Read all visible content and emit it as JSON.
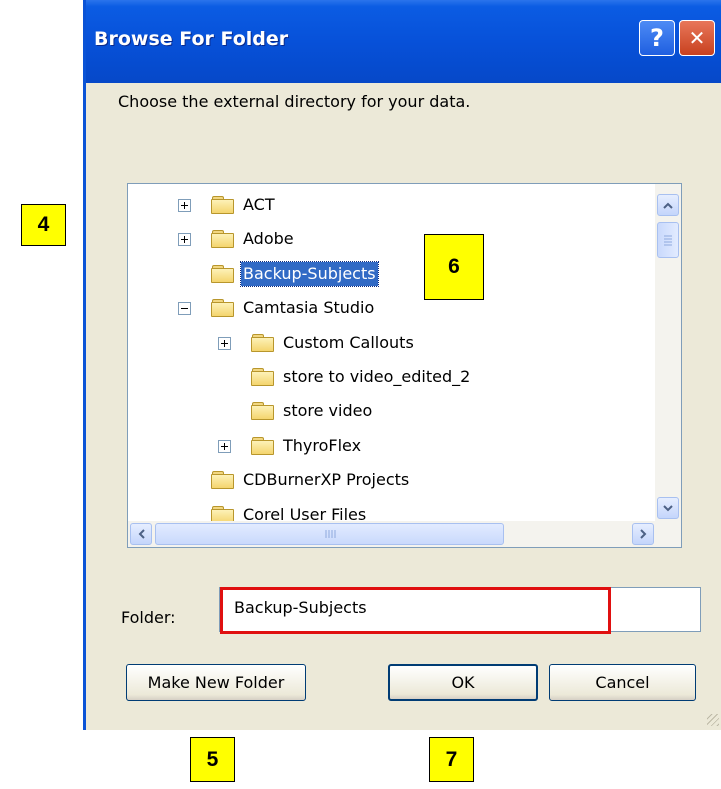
{
  "callouts": {
    "c4": "4",
    "c5": "5",
    "c6": "6",
    "c7": "7"
  },
  "dialog": {
    "title": "Browse For Folder",
    "help_glyph": "?",
    "close_glyph": "✕",
    "prompt": "Choose the external directory for your data."
  },
  "tree": {
    "items": [
      {
        "label": "ACT",
        "expander": "plus",
        "level": 0
      },
      {
        "label": "Adobe",
        "expander": "plus",
        "level": 0
      },
      {
        "label": "Backup-Subjects",
        "expander": "none",
        "level": 0,
        "selected": true
      },
      {
        "label": "Camtasia Studio",
        "expander": "minus",
        "level": 0
      },
      {
        "label": "Custom Callouts",
        "expander": "plus",
        "level": 1
      },
      {
        "label": "store to video_edited_2",
        "expander": "none",
        "level": 1
      },
      {
        "label": "store video",
        "expander": "none",
        "level": 1
      },
      {
        "label": "ThyroFlex",
        "expander": "plus",
        "level": 1
      },
      {
        "label": "CDBurnerXP Projects",
        "expander": "none",
        "level": 0
      },
      {
        "label": "Corel User Files",
        "expander": "none",
        "level": 0
      }
    ]
  },
  "folder_field": {
    "label": "Folder:",
    "value": "Backup-Subjects"
  },
  "buttons": {
    "make_new_folder": "Make New Folder",
    "ok": "OK",
    "cancel": "Cancel"
  },
  "icons": {
    "scroll_up": "up-arrow-icon",
    "scroll_down": "down-arrow-icon",
    "scroll_left": "left-arrow-icon",
    "scroll_right": "right-arrow-icon",
    "folder": "folder-icon"
  },
  "colors": {
    "titlebar": "#0751d9",
    "selection": "#316ac5",
    "highlight_box": "#e01010",
    "callout": "#ffff00"
  }
}
